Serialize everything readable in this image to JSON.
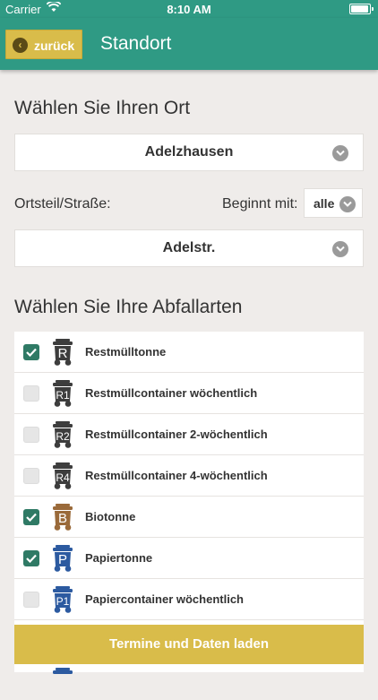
{
  "status": {
    "carrier": "Carrier",
    "time": "8:10 AM"
  },
  "nav": {
    "back_label": "zurück",
    "title": "Standort"
  },
  "location": {
    "heading": "Wählen Sie Ihren Ort",
    "town": "Adelzhausen",
    "street_label": "Ortsteil/Straße:",
    "filter_label": "Beginnt mit:",
    "filter_value": "alle",
    "street": "Adelstr."
  },
  "waste": {
    "heading": "Wählen Sie Ihre Abfallarten",
    "items": [
      {
        "label": "Restmülltonne",
        "checked": true,
        "bin_letter": "R",
        "bin_color": "#3d3d3d"
      },
      {
        "label": "Restmüllcontainer wöchentlich",
        "checked": false,
        "bin_letter": "R1",
        "bin_color": "#3d3d3d"
      },
      {
        "label": "Restmüllcontainer 2-wöchentlich",
        "checked": false,
        "bin_letter": "R2",
        "bin_color": "#3d3d3d"
      },
      {
        "label": "Restmüllcontainer 4-wöchentlich",
        "checked": false,
        "bin_letter": "R4",
        "bin_color": "#3d3d3d"
      },
      {
        "label": "Biotonne",
        "checked": true,
        "bin_letter": "B",
        "bin_color": "#9a6a3a"
      },
      {
        "label": "Papiertonne",
        "checked": true,
        "bin_letter": "P",
        "bin_color": "#2c5aa0"
      },
      {
        "label": "Papiercontainer wöchentlich",
        "checked": false,
        "bin_letter": "P1",
        "bin_color": "#2c5aa0"
      }
    ]
  },
  "actions": {
    "load_label": "Termine und Daten laden"
  },
  "colors": {
    "header": "#2f9a84",
    "accent": "#d9bc4a",
    "checked": "#2f7a65"
  }
}
